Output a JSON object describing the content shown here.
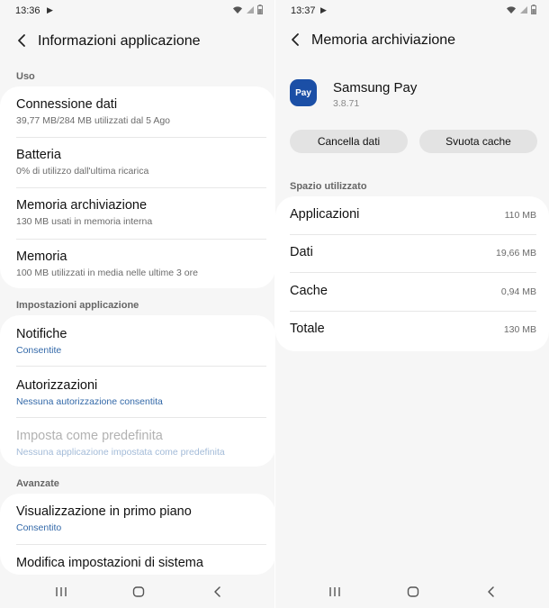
{
  "left": {
    "status": {
      "time": "13:36"
    },
    "header": {
      "title": "Informazioni applicazione"
    },
    "sections": {
      "usage": {
        "title": "Uso",
        "items": [
          {
            "title": "Connessione dati",
            "subtitle": "39,77 MB/284 MB utilizzati dal 5 Ago"
          },
          {
            "title": "Batteria",
            "subtitle": "0% di utilizzo dall'ultima ricarica"
          },
          {
            "title": "Memoria archiviazione",
            "subtitle": "130 MB usati in memoria interna"
          },
          {
            "title": "Memoria",
            "subtitle": "100 MB utilizzati in media nelle ultime 3 ore"
          }
        ]
      },
      "app_settings": {
        "title": "Impostazioni applicazione",
        "items": [
          {
            "title": "Notifiche",
            "subtitle": "Consentite"
          },
          {
            "title": "Autorizzazioni",
            "subtitle": "Nessuna autorizzazione consentita"
          },
          {
            "title": "Imposta come predefinita",
            "subtitle": "Nessuna applicazione impostata come predefinita"
          }
        ]
      },
      "advanced": {
        "title": "Avanzate",
        "items": [
          {
            "title": "Visualizzazione in primo piano",
            "subtitle": "Consentito"
          },
          {
            "title": "Modifica impostazioni di sistema"
          }
        ]
      }
    }
  },
  "right": {
    "status": {
      "time": "13:37"
    },
    "header": {
      "title": "Memoria archiviazione"
    },
    "app": {
      "icon_label": "Pay",
      "name": "Samsung Pay",
      "version": "3.8.71"
    },
    "buttons": {
      "clear_data": "Cancella dati",
      "clear_cache": "Svuota cache"
    },
    "storage": {
      "title": "Spazio utilizzato",
      "rows": [
        {
          "label": "Applicazioni",
          "value": "110 MB"
        },
        {
          "label": "Dati",
          "value": "19,66 MB"
        },
        {
          "label": "Cache",
          "value": "0,94 MB"
        },
        {
          "label": "Totale",
          "value": "130 MB"
        }
      ]
    }
  },
  "icons": {
    "status": [
      "play-icon",
      "wifi-icon",
      "signal-icon",
      "battery-icon"
    ],
    "navigation": [
      "recent-apps-icon",
      "home-icon",
      "back-icon"
    ]
  },
  "colors": {
    "accent": "#3268a8",
    "app_icon": "#1b4fa6",
    "background": "#f6f6f6",
    "card": "#ffffff",
    "button": "#e3e3e3"
  }
}
